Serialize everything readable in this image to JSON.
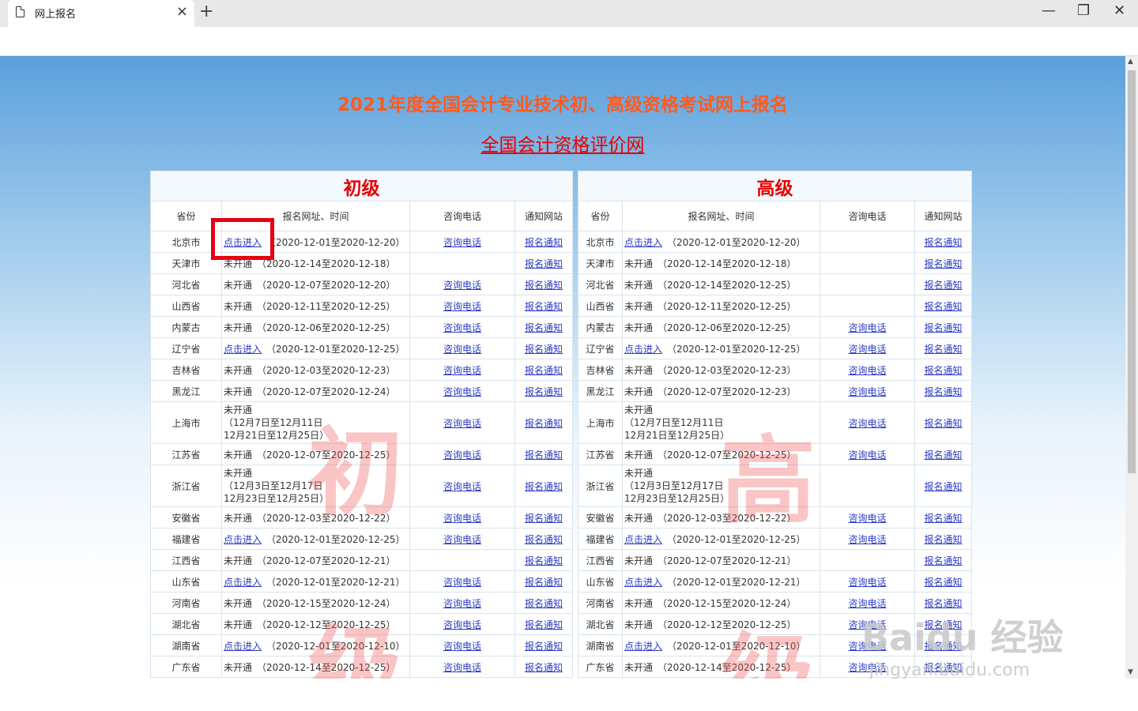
{
  "browser": {
    "tab_title": "网上报名",
    "new_tab": "+",
    "close": "×",
    "minimize": "—",
    "restore": "❐",
    "win_close": "✕"
  },
  "page": {
    "title": "2021年度全国会计专业技术初、高级资格考试网上报名",
    "site_link": "全国会计资格评价网"
  },
  "junior": {
    "caption": "初级",
    "headers": [
      "省份",
      "报名网址、时间",
      "咨询电话",
      "通知网站"
    ],
    "watermark": [
      "初",
      "级"
    ],
    "rows": [
      {
        "province": "北京市",
        "status": "点击进入",
        "time": "（2020-12-01至2020-12-20）",
        "phone": "咨询电话",
        "notice": "报名通知"
      },
      {
        "province": "天津市",
        "status": "未开通",
        "time": "（2020-12-14至2020-12-18）",
        "phone": "",
        "notice": "报名通知"
      },
      {
        "province": "河北省",
        "status": "未开通",
        "time": "（2020-12-07至2020-12-20）",
        "phone": "咨询电话",
        "notice": "报名通知"
      },
      {
        "province": "山西省",
        "status": "未开通",
        "time": "（2020-12-11至2020-12-25）",
        "phone": "咨询电话",
        "notice": "报名通知"
      },
      {
        "province": "内蒙古",
        "status": "未开通",
        "time": "（2020-12-06至2020-12-25）",
        "phone": "咨询电话",
        "notice": "报名通知"
      },
      {
        "province": "辽宁省",
        "status": "点击进入",
        "time": "（2020-12-01至2020-12-25）",
        "phone": "咨询电话",
        "notice": "报名通知"
      },
      {
        "province": "吉林省",
        "status": "未开通",
        "time": "（2020-12-03至2020-12-23）",
        "phone": "咨询电话",
        "notice": "报名通知"
      },
      {
        "province": "黑龙江",
        "status": "未开通",
        "time": "（2020-12-07至2020-12-24）",
        "phone": "咨询电话",
        "notice": "报名通知"
      },
      {
        "province": "上海市",
        "status": "未开通",
        "time": "（12月7日至12月11日",
        "time2": "12月21日至12月25日）",
        "phone": "咨询电话",
        "notice": "报名通知"
      },
      {
        "province": "江苏省",
        "status": "未开通",
        "time": "（2020-12-07至2020-12-25）",
        "phone": "咨询电话",
        "notice": "报名通知"
      },
      {
        "province": "浙江省",
        "status": "未开通",
        "time": "（12月3日至12月17日",
        "time2": "12月23日至12月25日）",
        "phone": "咨询电话",
        "notice": "报名通知"
      },
      {
        "province": "安徽省",
        "status": "未开通",
        "time": "（2020-12-03至2020-12-22）",
        "phone": "咨询电话",
        "notice": "报名通知"
      },
      {
        "province": "福建省",
        "status": "点击进入",
        "time": "（2020-12-01至2020-12-25）",
        "phone": "咨询电话",
        "notice": "报名通知"
      },
      {
        "province": "江西省",
        "status": "未开通",
        "time": "（2020-12-07至2020-12-21）",
        "phone": "",
        "notice": "报名通知"
      },
      {
        "province": "山东省",
        "status": "点击进入",
        "time": "（2020-12-01至2020-12-21）",
        "phone": "咨询电话",
        "notice": "报名通知"
      },
      {
        "province": "河南省",
        "status": "未开通",
        "time": "（2020-12-15至2020-12-24）",
        "phone": "咨询电话",
        "notice": "报名通知"
      },
      {
        "province": "湖北省",
        "status": "未开通",
        "time": "（2020-12-12至2020-12-25）",
        "phone": "咨询电话",
        "notice": "报名通知"
      },
      {
        "province": "湖南省",
        "status": "点击进入",
        "time": "（2020-12-01至2020-12-10）",
        "phone": "咨询电话",
        "notice": "报名通知"
      },
      {
        "province": "广东省",
        "status": "未开通",
        "time": "（2020-12-14至2020-12-25）",
        "phone": "咨询电话",
        "notice": "报名通知"
      }
    ]
  },
  "senior": {
    "caption": "高级",
    "headers": [
      "省份",
      "报名网址、时间",
      "咨询电话",
      "通知网站"
    ],
    "watermark": [
      "高",
      "级"
    ],
    "rows": [
      {
        "province": "北京市",
        "status": "点击进入",
        "time": "（2020-12-01至2020-12-20）",
        "phone": "",
        "notice": "报名通知"
      },
      {
        "province": "天津市",
        "status": "未开通",
        "time": "（2020-12-14至2020-12-18）",
        "phone": "",
        "notice": "报名通知"
      },
      {
        "province": "河北省",
        "status": "未开通",
        "time": "（2020-12-14至2020-12-25）",
        "phone": "",
        "notice": "报名通知"
      },
      {
        "province": "山西省",
        "status": "未开通",
        "time": "（2020-12-11至2020-12-25）",
        "phone": "",
        "notice": "报名通知"
      },
      {
        "province": "内蒙古",
        "status": "未开通",
        "time": "（2020-12-06至2020-12-25）",
        "phone": "咨询电话",
        "notice": "报名通知"
      },
      {
        "province": "辽宁省",
        "status": "点击进入",
        "time": "（2020-12-01至2020-12-25）",
        "phone": "咨询电话",
        "notice": "报名通知"
      },
      {
        "province": "吉林省",
        "status": "未开通",
        "time": "（2020-12-03至2020-12-23）",
        "phone": "咨询电话",
        "notice": "报名通知"
      },
      {
        "province": "黑龙江",
        "status": "未开通",
        "time": "（2020-12-07至2020-12-23）",
        "phone": "咨询电话",
        "notice": "报名通知"
      },
      {
        "province": "上海市",
        "status": "未开通",
        "time": "（12月7日至12月11日",
        "time2": "12月21日至12月25日）",
        "phone": "咨询电话",
        "notice": "报名通知"
      },
      {
        "province": "江苏省",
        "status": "未开通",
        "time": "（2020-12-07至2020-12-25）",
        "phone": "咨询电话",
        "notice": "报名通知"
      },
      {
        "province": "浙江省",
        "status": "未开通",
        "time": "（12月3日至12月17日",
        "time2": "12月23日至12月25日）",
        "phone": "",
        "notice": "报名通知"
      },
      {
        "province": "安徽省",
        "status": "未开通",
        "time": "（2020-12-03至2020-12-22）",
        "phone": "咨询电话",
        "notice": "报名通知"
      },
      {
        "province": "福建省",
        "status": "点击进入",
        "time": "（2020-12-01至2020-12-25）",
        "phone": "咨询电话",
        "notice": "报名通知"
      },
      {
        "province": "江西省",
        "status": "未开通",
        "time": "（2020-12-07至2020-12-21）",
        "phone": "",
        "notice": "报名通知"
      },
      {
        "province": "山东省",
        "status": "点击进入",
        "time": "（2020-12-01至2020-12-21）",
        "phone": "咨询电话",
        "notice": "报名通知"
      },
      {
        "province": "河南省",
        "status": "未开通",
        "time": "（2020-12-15至2020-12-24）",
        "phone": "咨询电话",
        "notice": "报名通知"
      },
      {
        "province": "湖北省",
        "status": "未开通",
        "time": "（2020-12-12至2020-12-25）",
        "phone": "咨询电话",
        "notice": "报名通知"
      },
      {
        "province": "湖南省",
        "status": "点击进入",
        "time": "（2020-12-01至2020-12-10）",
        "phone": "咨询电话",
        "notice": "报名通知"
      },
      {
        "province": "广东省",
        "status": "未开通",
        "time": "（2020-12-14至2020-12-25）",
        "phone": "咨询电话",
        "notice": "报名通知"
      }
    ]
  },
  "watermark_site": {
    "logo": "Baidu 经验",
    "url": "jingyan.baidu.com"
  }
}
